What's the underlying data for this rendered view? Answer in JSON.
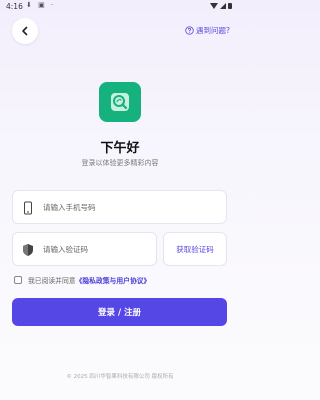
{
  "status_bar": {
    "time": "4:16",
    "left_icons": "⬇ ▣ ·"
  },
  "header": {
    "back_icon": "chevron-left-icon",
    "help_icon": "question-circle-icon",
    "help_label": "遇到问题?"
  },
  "logo": {
    "icon": "search-leaf-icon",
    "color": "#15b27d"
  },
  "greeting": "下午好",
  "subtitle": "登录以体验更多精彩内容",
  "phone_field": {
    "icon": "phone-icon",
    "placeholder": "请输入手机号码",
    "value": ""
  },
  "code_field": {
    "icon": "shield-icon",
    "placeholder": "请输入验证码",
    "value": ""
  },
  "get_code_label": "获取验证码",
  "agreement": {
    "text": "我已阅读并同意",
    "link": "《隐私政策与用户协议》",
    "checked": false
  },
  "login_button_label": "登录 / 注册",
  "footer": "© 2025 四川华智果科技有限公司 版权所有",
  "colors": {
    "accent": "#5546e6",
    "link": "#4a3dd8",
    "logo": "#15b27d"
  }
}
